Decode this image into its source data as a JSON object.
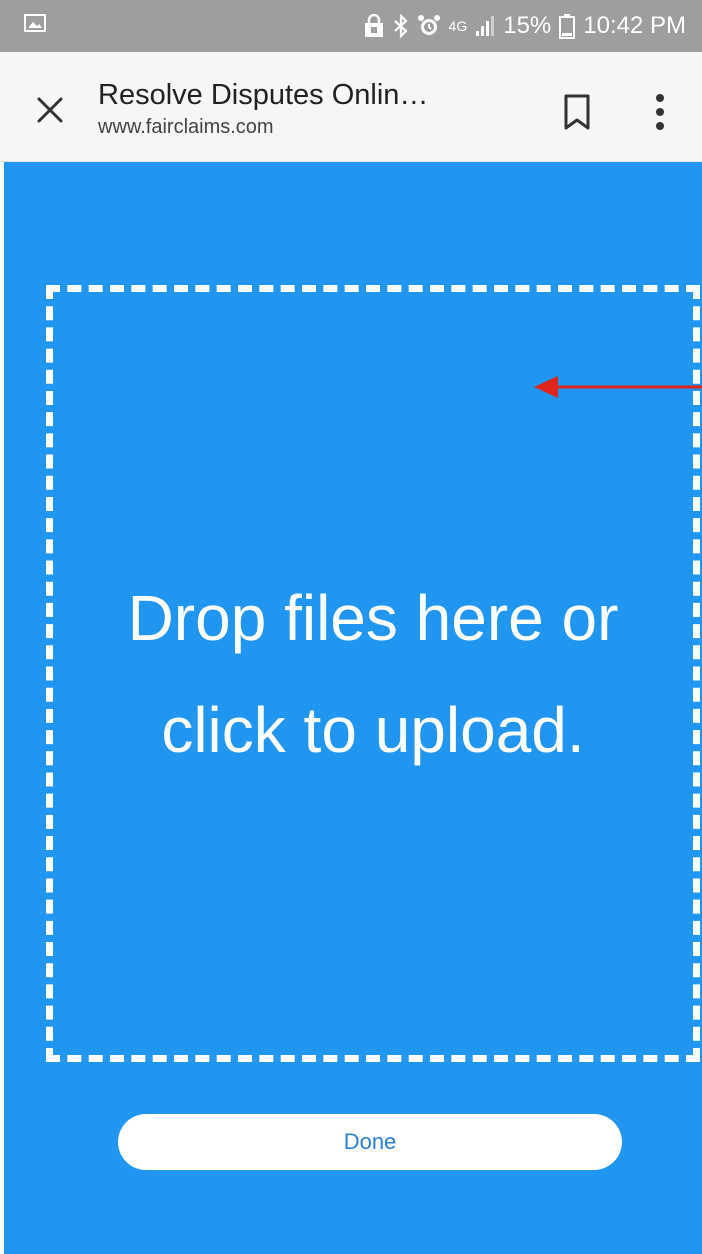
{
  "status_bar": {
    "battery_percent": "15%",
    "time": "10:42 PM",
    "network_label": "4G",
    "icons": [
      "image-icon",
      "lock-icon",
      "bluetooth-icon",
      "alarm-icon",
      "lte-icon",
      "signal-icon",
      "battery-icon"
    ]
  },
  "toolbar": {
    "title": "Resolve Disputes Onlin…",
    "url": "www.fairclaims.com",
    "icons": [
      "close-icon",
      "bookmark-icon",
      "more-vert-icon"
    ]
  },
  "upload": {
    "dropzone_text": "Drop files here or click to upload.",
    "done_label": "Done"
  },
  "colors": {
    "status_bar_bg": "#9e9e9e",
    "toolbar_bg": "#f6f6f6",
    "content_bg": "#2196f0",
    "done_text": "#2a7fd6",
    "annotation_arrow": "#e0261b"
  }
}
